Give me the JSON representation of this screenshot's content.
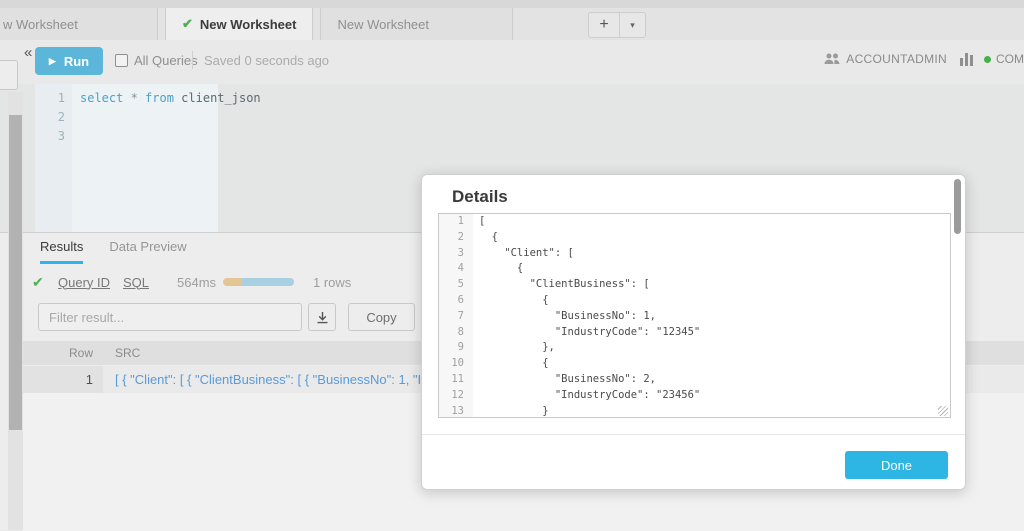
{
  "icons": {
    "check": "✔",
    "collapse": "«",
    "plus": "+",
    "caret_down": "▾",
    "play": "▶",
    "sort_up": "▲"
  },
  "tabs": {
    "items": [
      {
        "label": "w Worksheet",
        "active": false
      },
      {
        "label": "New Worksheet",
        "active": true
      },
      {
        "label": "New Worksheet",
        "active": false
      }
    ]
  },
  "toolbar": {
    "run_label": "Run",
    "all_queries_label": "All Queries",
    "saved_status": "Saved 0 seconds ago",
    "role_name": "ACCOUNTADMIN",
    "warehouse_text": "COM"
  },
  "editor": {
    "line_numbers": [
      "1",
      "2",
      "3"
    ],
    "code": {
      "select_kw": "select",
      "star": " * ",
      "from_kw": "from",
      "table_name": " client_json"
    }
  },
  "results": {
    "tab_results": "Results",
    "tab_data_preview": "Data Preview",
    "query_id_label": "Query ID",
    "sql_label": "SQL",
    "duration": "564ms",
    "rows_count": "1 rows",
    "filter_placeholder": "Filter result...",
    "copy_label": "Copy",
    "table": {
      "columns": [
        "Row",
        "SRC"
      ],
      "rows": [
        {
          "row_num": "1",
          "src": "[ { \"Client\": [ { \"ClientBusiness\": [ { \"BusinessNo\": 1, \"Ind"
        }
      ]
    }
  },
  "modal": {
    "title": "Details",
    "done_label": "Done",
    "json_lines": [
      {
        "num": "1",
        "text": "["
      },
      {
        "num": "2",
        "text": "  {"
      },
      {
        "num": "3",
        "text": "    \"Client\": ["
      },
      {
        "num": "4",
        "text": "      {"
      },
      {
        "num": "5",
        "text": "        \"ClientBusiness\": ["
      },
      {
        "num": "6",
        "text": "          {"
      },
      {
        "num": "7",
        "text": "            \"BusinessNo\": 1,"
      },
      {
        "num": "8",
        "text": "            \"IndustryCode\": \"12345\""
      },
      {
        "num": "9",
        "text": "          },"
      },
      {
        "num": "10",
        "text": "          {"
      },
      {
        "num": "11",
        "text": "            \"BusinessNo\": 2,"
      },
      {
        "num": "12",
        "text": "            \"IndustryCode\": \"23456\""
      },
      {
        "num": "13",
        "text": "          }"
      }
    ]
  },
  "colors": {
    "accent_blue": "#2db5e3",
    "run_button_blue": "#5bb6da",
    "success_green": "#4caf50",
    "result_link_blue": "#5a9bd8",
    "progress_tan": "#e3c693",
    "progress_blue": "#a9cfe2"
  }
}
